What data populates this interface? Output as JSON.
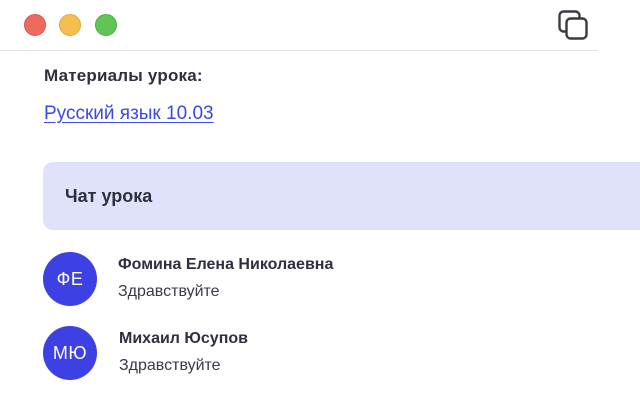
{
  "window": {
    "buttons": [
      "close",
      "minimize",
      "maximize"
    ],
    "toolbar_icon": "copy-icon"
  },
  "materials": {
    "title": "Материалы урока:",
    "link_label": "Русский язык 10.03"
  },
  "chat": {
    "title": "Чат урока",
    "messages": [
      {
        "initials": "ФЕ",
        "sender": "Фомина Елена Николаевна",
        "text": "Здравствуйте"
      },
      {
        "initials": "МЮ",
        "sender": "Михаил Юсупов",
        "text": "Здравствуйте"
      }
    ]
  },
  "colors": {
    "accent": "#3d41e3",
    "link": "#3a49e6",
    "chat_header_bg": "#e0e2fb",
    "close": "#ee6a5e",
    "minimize": "#f5bf4f",
    "maximize": "#61c554"
  }
}
